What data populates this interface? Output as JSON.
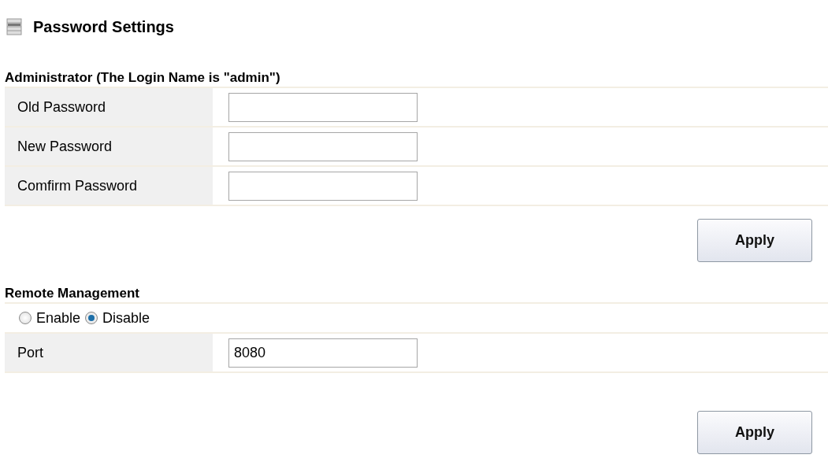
{
  "title": "Password Settings",
  "administrator": {
    "heading": "Administrator (The Login Name is \"admin\")",
    "fields": [
      {
        "label": "Old Password"
      },
      {
        "label": "New Password"
      },
      {
        "label": "Comfirm Password"
      }
    ],
    "apply_button": "Apply"
  },
  "remote_management": {
    "heading": "Remote Management",
    "options": [
      {
        "label": "Enable",
        "selected": false
      },
      {
        "label": "Disable",
        "selected": true
      }
    ],
    "port": {
      "label": "Port",
      "value": "8080"
    },
    "apply_button": "Apply"
  }
}
